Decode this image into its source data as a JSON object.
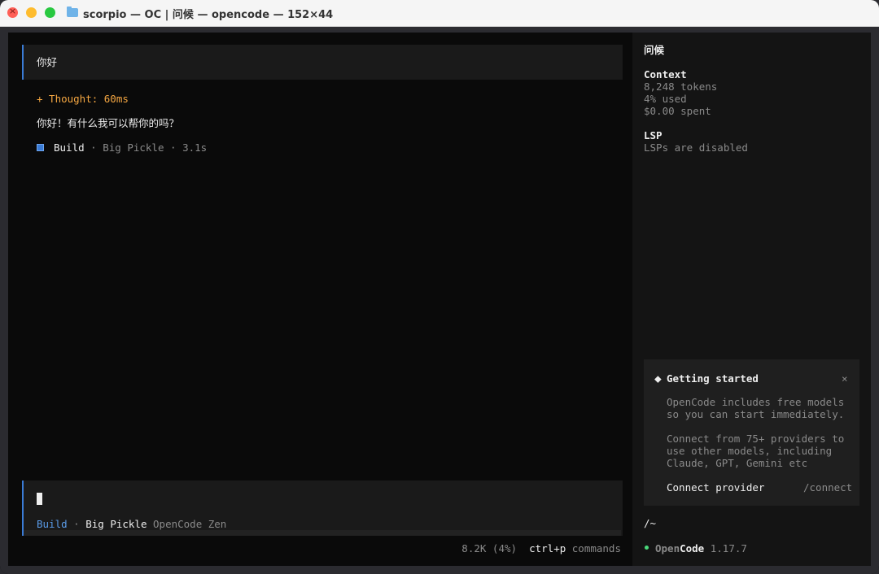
{
  "window": {
    "title": "scorpio — OC | 问候 — opencode — 152×44"
  },
  "chat": {
    "user_message": "你好",
    "thought_label": "+ Thought: 60ms",
    "assistant_reply": "你好！有什么我可以帮你的吗？",
    "meta": {
      "agent": "Build",
      "sep1": " · ",
      "model": "Big Pickle",
      "sep2": " · ",
      "duration": "3.1s"
    }
  },
  "input": {
    "agent": "Build",
    "sep": " · ",
    "model": "Big Pickle",
    "provider": "OpenCode Zen"
  },
  "statusbar": {
    "tokens": "8.2K (4%)",
    "shortcut_key": "ctrl+p",
    "shortcut_label": "commands"
  },
  "sidebar": {
    "session_title": "问候",
    "context_heading": "Context",
    "context_lines": [
      "8,248 tokens",
      "4% used",
      "$0.00 spent"
    ],
    "lsp_heading": "LSP",
    "lsp_status": "LSPs are disabled",
    "getting_started": {
      "icon": "⬥",
      "title": "Getting started",
      "close": "×",
      "para1": [
        "OpenCode includes free models",
        "so you can start immediately."
      ],
      "para2": [
        "Connect from 75+ providers to",
        "use other models, including",
        "Claude, GPT, Gemini etc"
      ],
      "action_label": "Connect provider",
      "action_command": "/connect"
    },
    "path": "/~",
    "app_name_part1": "Open",
    "app_name_part2": "Code",
    "version": "1.17.7"
  },
  "colors": {
    "accent_blue": "#3a7bd5",
    "thought_orange": "#f5a742",
    "status_green": "#4ad97b"
  }
}
